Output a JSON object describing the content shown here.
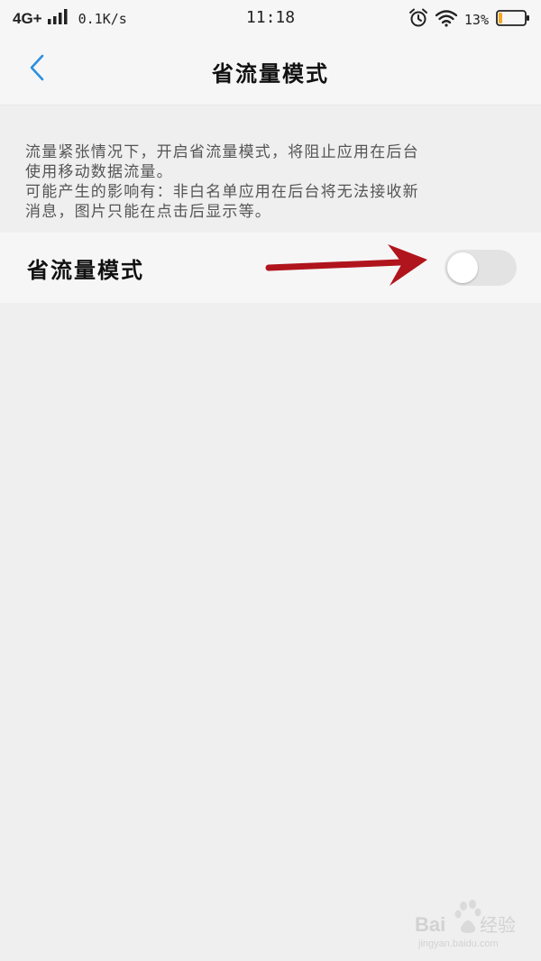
{
  "status_bar": {
    "network": "4G+",
    "speed": "0.1K/s",
    "time": "11:18",
    "battery_percent": "13%",
    "battery_level": 0.13,
    "battery_color": "#f5a623",
    "icons": [
      "signal-icon",
      "alarm-icon",
      "wifi-icon",
      "battery-icon"
    ]
  },
  "header": {
    "title": "省流量模式",
    "back_icon": "chevron-left-icon",
    "accent_color": "#2a8fe0"
  },
  "description": {
    "line1": "流量紧张情况下，开启省流量模式，将阻止应用在后台",
    "line2": "使用移动数据流量。",
    "line3": "可能产生的影响有：非白名单应用在后台将无法接收新",
    "line4": "消息，图片只能在点击后显示等。"
  },
  "setting": {
    "label": "省流量模式",
    "enabled": false
  },
  "annotation": {
    "arrow_color": "#b0141c"
  }
}
